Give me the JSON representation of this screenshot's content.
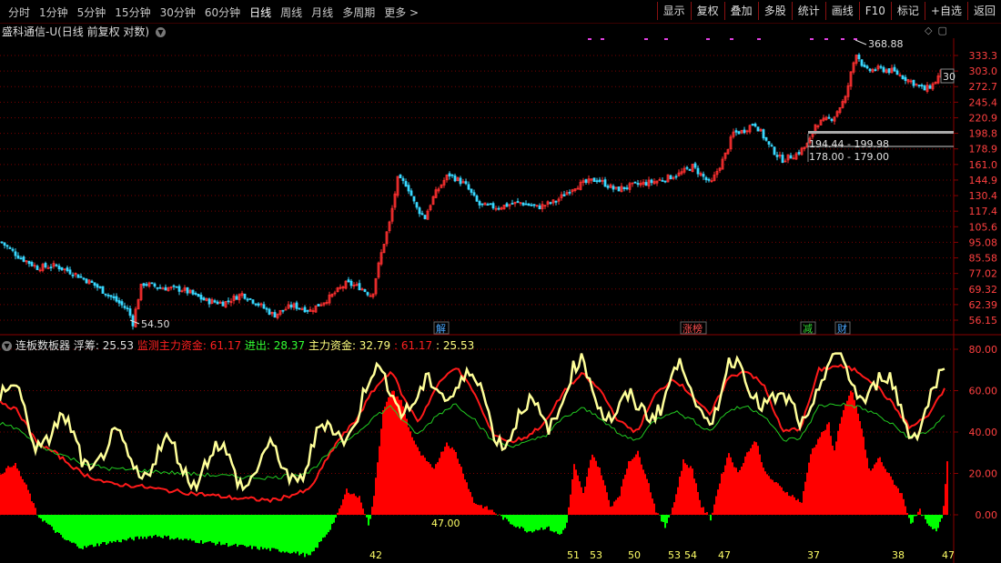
{
  "toolbar": {
    "periods": [
      "分时",
      "1分钟",
      "5分钟",
      "15分钟",
      "30分钟",
      "60分钟",
      "日线",
      "周线",
      "月线",
      "多周期",
      "更多 >"
    ],
    "active_period": "日线",
    "right_buttons": [
      "显示",
      "复权",
      "叠加",
      "多股",
      "统计",
      "画线",
      "F10",
      "标记",
      "+自选",
      "返回"
    ]
  },
  "chart_title": "盛科通信-U(日线 前复权 对数)",
  "price_axis": [
    "333.3",
    "303.0",
    "272.7",
    "245.4",
    "220.9",
    "198.8",
    "178.9",
    "161.0",
    "144.9",
    "130.4",
    "117.4",
    "105.6",
    "95.08",
    "85.58",
    "77.02",
    "69.32",
    "62.39",
    "56.15"
  ],
  "annotations": {
    "high": "368.88",
    "low": "54.50",
    "zone_upper": "194.44 - 199.98",
    "zone_lower": "178.00 - 179.00",
    "right_cut": "30"
  },
  "event_tags": [
    {
      "text": "解",
      "color": "#4aa8ff"
    },
    {
      "text": "涨榜",
      "color": "#ff5050"
    },
    {
      "text": "减",
      "color": "#33dd33"
    },
    {
      "text": "财",
      "color": "#4aa8ff"
    }
  ],
  "indicator": {
    "name": "连板数板器",
    "fields": [
      {
        "label": "浮筹: 25.53",
        "color": "#e0e0e0"
      },
      {
        "label": "监测主力资金: 61.17",
        "color": "#ff2020"
      },
      {
        "label": "进出: 28.37",
        "color": "#33ff33"
      },
      {
        "label": "主力资金: 32.79",
        "color": "#ffff80"
      },
      {
        "label": ": 61.17",
        "color": "#ff2020"
      },
      {
        "label": ": 25.53",
        "color": "#ffff80"
      }
    ],
    "axis": [
      "80.00",
      "60.00",
      "40.00",
      "20.00",
      "0.00"
    ],
    "mid_label": "47.00",
    "bottom_numbers": [
      "42",
      "51",
      "53",
      "50",
      "53",
      "54",
      "47",
      "37",
      "38",
      "47"
    ]
  },
  "colors": {
    "up_candle": "#ff3030",
    "down_candle": "#38d8ff",
    "grid": "#7a0000",
    "red_area": "#ff0000",
    "green_area": "#00ff00",
    "yellow_line": "#ffff99",
    "text_yellow": "#ffff66"
  }
}
